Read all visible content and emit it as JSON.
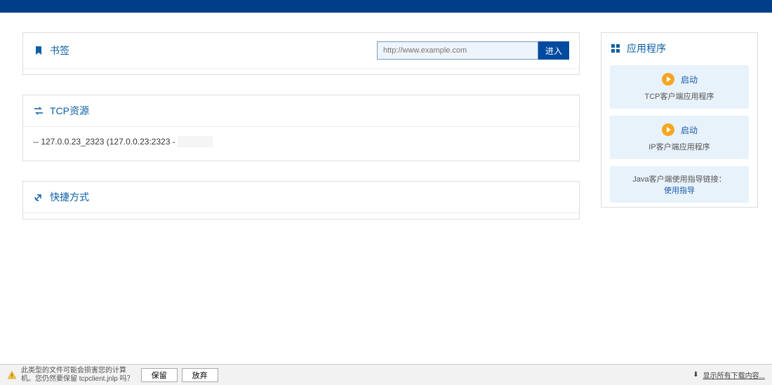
{
  "bookmarks": {
    "title": "书签",
    "url_placeholder": "http://www.example.com",
    "enter_label": "进入"
  },
  "tcp": {
    "title": "TCP资源",
    "items": [
      {
        "prefix": "-- 127.0.0.23_2323 (127.0.0.23:2323 - ",
        "faded": "          ",
        "suffix": ")"
      }
    ]
  },
  "shortcut": {
    "title": "快捷方式"
  },
  "apps": {
    "title": "应用程序",
    "cards": [
      {
        "launch": "启动",
        "sub": "TCP客户端应用程序"
      },
      {
        "launch": "启动",
        "sub": "IP客户端应用程序"
      }
    ],
    "java_hint": "Java客户端使用指导链接：",
    "java_link": "使用指导"
  },
  "download": {
    "warn1": "此类型的文件可能会损害您的计算",
    "warn2": "机。您仍然要保留 tcpclient.jnlp 吗？",
    "keep": "保留",
    "discard": "放弃",
    "show_all": "显示所有下载内容..."
  }
}
